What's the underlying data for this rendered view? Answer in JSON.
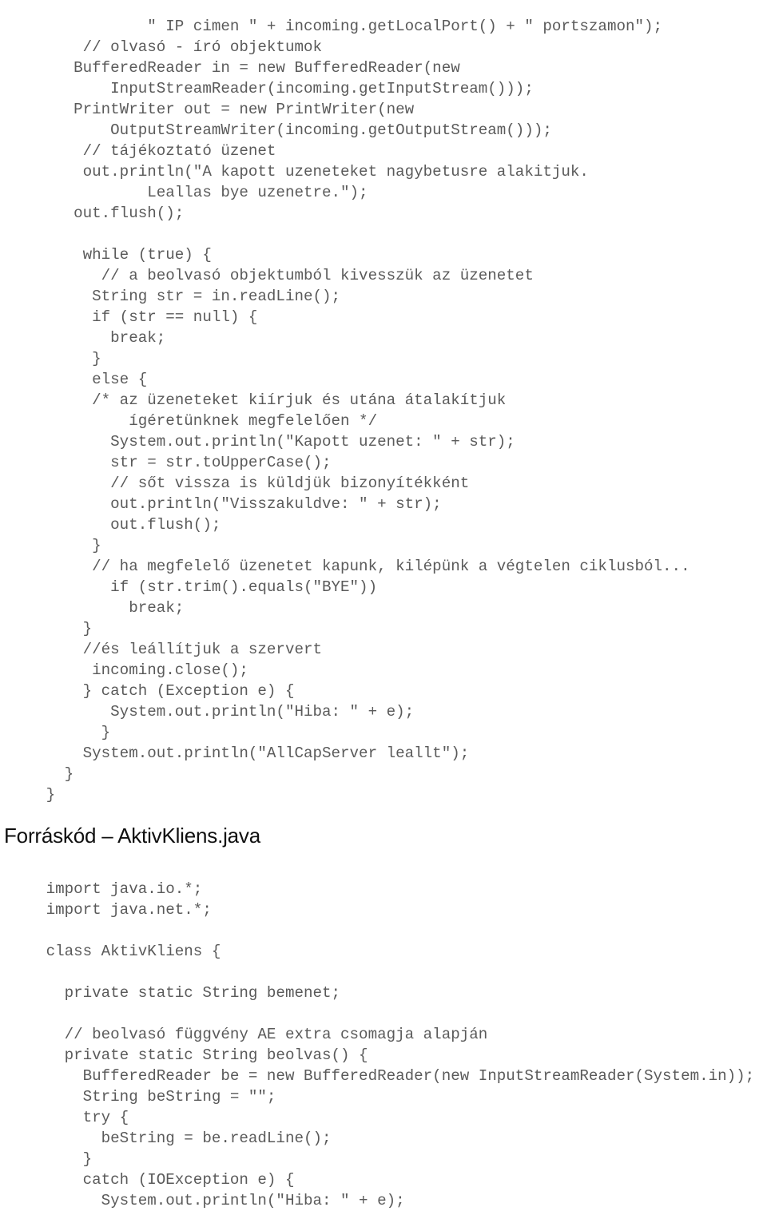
{
  "document": {
    "page_background": "#ffffff",
    "code_color": "#5a5a5a",
    "heading_color": "#0f0f0f"
  },
  "heading": {
    "text": "Forráskód – AktivKliens.java"
  },
  "code_top": {
    "language": "java",
    "lines": [
      "                \" IP cimen \" + incoming.getLocalPort() + \" portszamon\");",
      "         // olvasó - író objektumok",
      "        BufferedReader in = new BufferedReader(new",
      "            InputStreamReader(incoming.getInputStream()));",
      "        PrintWriter out = new PrintWriter(new",
      "            OutputStreamWriter(incoming.getOutputStream()));",
      "         // tájékoztató üzenet",
      "         out.println(\"A kapott uzeneteket nagybetusre alakitjuk.",
      "                Leallas bye uzenetre.\");",
      "        out.flush();",
      "",
      "         while (true) {",
      "           // a beolvasó objektumból kivesszük az üzenetet",
      "          String str = in.readLine();",
      "          if (str == null) {",
      "            break;",
      "          }",
      "          else {",
      "          /* az üzeneteket kiírjuk és utána átalakítjuk",
      "              ígéretünknek megfelelően */",
      "            System.out.println(\"Kapott uzenet: \" + str);",
      "            str = str.toUpperCase();",
      "            // sőt vissza is küldjük bizonyítékként",
      "            out.println(\"Visszakuldve: \" + str);",
      "            out.flush();",
      "          }",
      "          // ha megfelelő üzenetet kapunk, kilépünk a végtelen ciklusból...",
      "            if (str.trim().equals(\"BYE\"))",
      "              break;",
      "         }",
      "         //és leállítjuk a szervert",
      "          incoming.close();",
      "         } catch (Exception e) {",
      "            System.out.println(\"Hiba: \" + e);",
      "           }",
      "         System.out.println(\"AllCapServer leallt\");",
      "       }",
      "     }"
    ]
  },
  "code_bottom": {
    "language": "java",
    "lines": [
      "     import java.io.*;",
      "     import java.net.*;",
      "",
      "     class AktivKliens {",
      "",
      "       private static String bemenet;",
      "",
      "       // beolvasó függvény AE extra csomagja alapján",
      "       private static String beolvas() {",
      "         BufferedReader be = new BufferedReader(new InputStreamReader(System.in));",
      "         String beString = \"\";",
      "         try {",
      "           beString = be.readLine();",
      "         }",
      "         catch (IOException e) {",
      "           System.out.println(\"Hiba: \" + e);"
    ]
  }
}
